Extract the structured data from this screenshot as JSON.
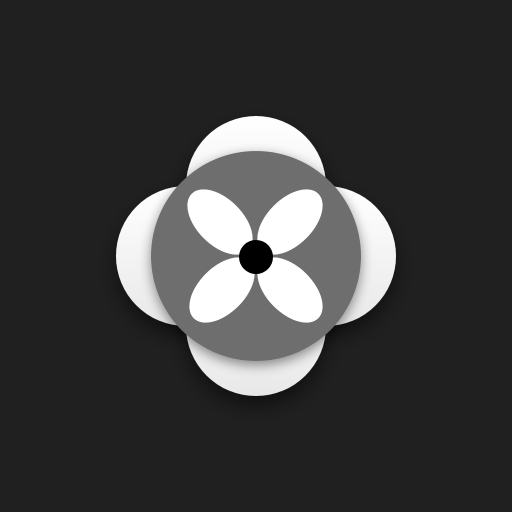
{
  "icon": {
    "name": "fan-icon",
    "colors": {
      "background": "#202020",
      "outer_lobes": "#ffffff",
      "inner_disc": "#6e6e6e",
      "blades": "#ffffff",
      "hub": "#000000"
    }
  }
}
